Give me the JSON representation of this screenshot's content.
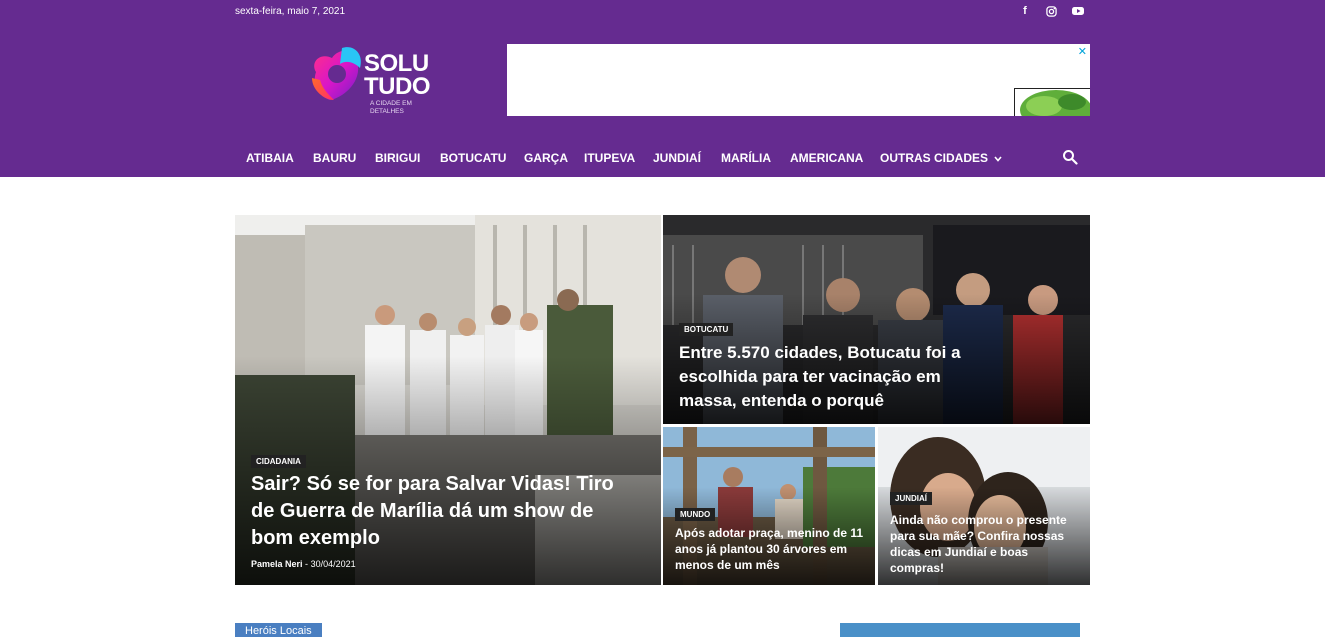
{
  "topbar": {
    "date": "sexta-feira, maio 7, 2021",
    "social": [
      {
        "icon": "facebook-icon",
        "glyph": "f"
      },
      {
        "icon": "instagram-icon",
        "glyph": "◎"
      },
      {
        "icon": "youtube-icon",
        "glyph": "▶"
      }
    ]
  },
  "logo": {
    "line1": "SOLU",
    "line2": "TUDO",
    "tagline": "A CIDADE EM DETALHES"
  },
  "ad": {
    "close_label": "✕"
  },
  "nav": {
    "items": [
      {
        "label": "ATIBAIA"
      },
      {
        "label": "BAURU"
      },
      {
        "label": "BIRIGUI"
      },
      {
        "label": "BOTUCATU"
      },
      {
        "label": "GARÇA"
      },
      {
        "label": "ITUPEVA"
      },
      {
        "label": "JUNDIAÍ"
      },
      {
        "label": "MARÍLIA"
      },
      {
        "label": "AMERICANA"
      },
      {
        "label": "OUTRAS CIDADES"
      }
    ],
    "more_glyph": "⌄"
  },
  "featured": {
    "main": {
      "category": "CIDADANIA",
      "title": "Sair? Só se for para Salvar Vidas! Tiro de Guerra de Marília dá um show de bom exemplo",
      "author": "Pamela Neri",
      "separator": "-",
      "date": "30/04/2021"
    },
    "top_right": {
      "category": "BOTUCATU",
      "title": "Entre 5.570 cidades, Botucatu foi a escolhida para ter vacinação em massa, entenda o porquê"
    },
    "bottom_left": {
      "category": "MUNDO",
      "title": "Após adotar praça, menino de 11 anos já plantou 30 árvores em menos de um mês"
    },
    "bottom_right": {
      "category": "JUNDIAÍ",
      "title": "Ainda não comprou o presente para sua mãe? Confira nossas dicas em Jundiaí e boas compras!"
    }
  },
  "sections": {
    "locals_tab": "Heróis Locais"
  },
  "colors": {
    "header": "#652b90",
    "category_bg": "#222222",
    "section_tab": "#4a7fc1"
  }
}
